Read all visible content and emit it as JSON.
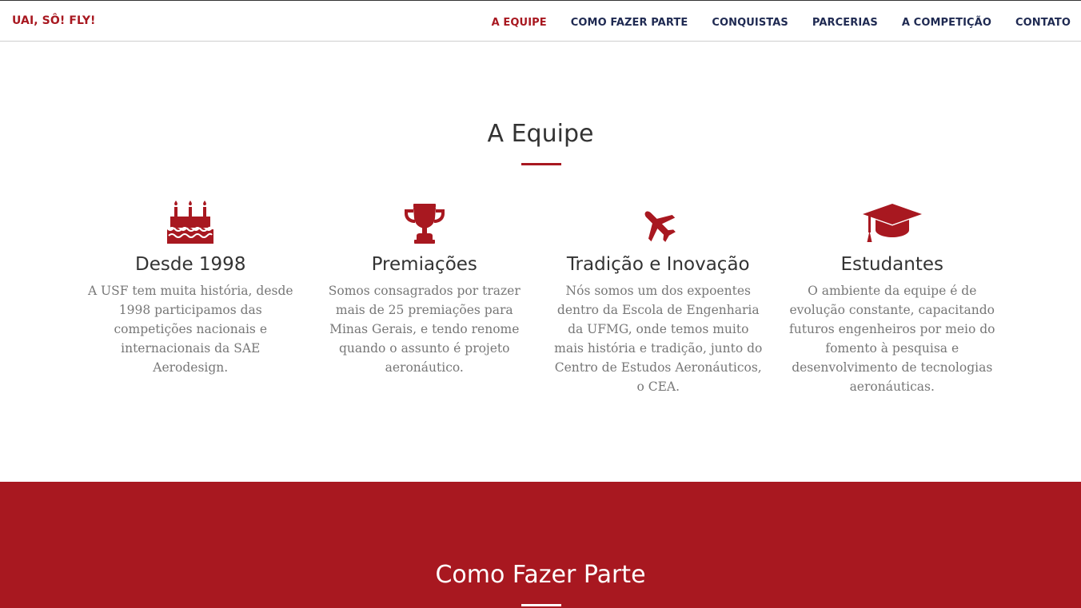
{
  "navbar": {
    "brand": "UAI, SÔ! FLY!",
    "items": [
      {
        "label": "A EQUIPE",
        "active": true
      },
      {
        "label": "COMO FAZER PARTE"
      },
      {
        "label": "CONQUISTAS"
      },
      {
        "label": "PARCERIAS"
      },
      {
        "label": "A COMPETIÇÃO"
      },
      {
        "label": "CONTATO"
      }
    ]
  },
  "equipe": {
    "title": "A Equipe",
    "features": [
      {
        "icon": "birthday-cake-icon",
        "title": "Desde 1998",
        "text": "A USF tem muita história, desde 1998 participamos das competições nacionais e internacionais da SAE Aerodesign."
      },
      {
        "icon": "trophy-icon",
        "title": "Premiações",
        "text": "Somos consagrados por trazer mais de 25 premiações para Minas Gerais, e tendo renome quando o assunto é projeto aeronáutico."
      },
      {
        "icon": "plane-icon",
        "title": "Tradição e Inovação",
        "text": "Nós somos um dos expoentes dentro da Escola de Engenharia da UFMG, onde temos muito mais história e tradição, junto do Centro de Estudos Aeronáuticos, o CEA."
      },
      {
        "icon": "graduation-cap-icon",
        "title": "Estudantes",
        "text": "O ambiente da equipe é de evolução constante, capacitando futuros engenheiros por meio do fomento à pesquisa e desenvolvimento de tecnologias aeronáuticas."
      }
    ]
  },
  "como": {
    "title": "Como Fazer Parte"
  },
  "colors": {
    "primary": "#a81820",
    "nav_text": "#1f2a52"
  }
}
